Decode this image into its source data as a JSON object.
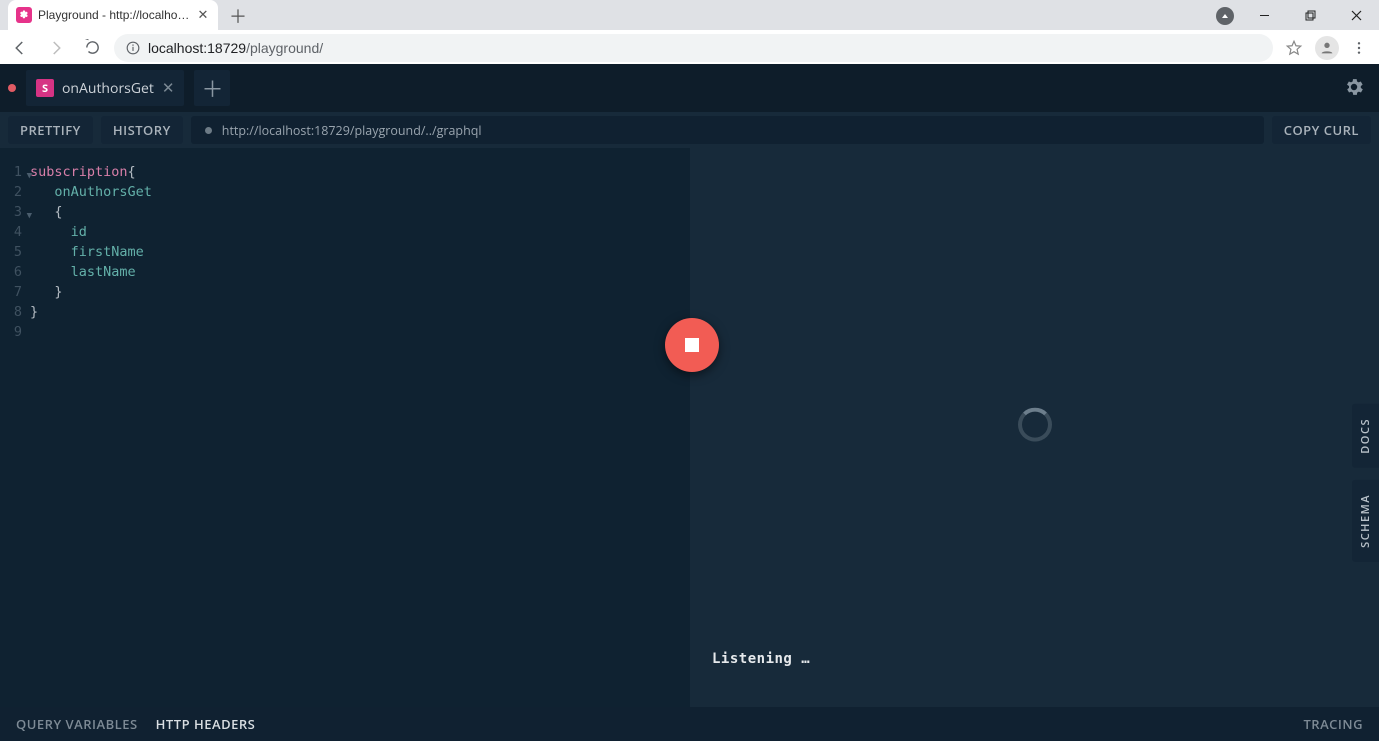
{
  "browser": {
    "tab_title": "Playground - http://localhost:187",
    "url_prefix": "localhost:18729",
    "url_path": "/playground/",
    "window_controls": {
      "min": "minimize",
      "max": "restore",
      "close": "close"
    }
  },
  "app": {
    "tab": {
      "kind": "S",
      "name": "onAuthorsGet"
    },
    "settings_icon": "gear",
    "toolbar": {
      "prettify": "PRETTIFY",
      "history": "HISTORY",
      "copy_curl": "COPY CURL",
      "endpoint": "http://localhost:18729/playground/../graphql"
    },
    "editor": {
      "lines": [
        {
          "n": 1,
          "fold": true,
          "tokens": [
            [
              "kw",
              "subscription"
            ],
            [
              "brace",
              "{"
            ]
          ]
        },
        {
          "n": 2,
          "fold": false,
          "tokens": [
            [
              "plain",
              "   "
            ],
            [
              "field",
              "onAuthorsGet"
            ]
          ]
        },
        {
          "n": 3,
          "fold": true,
          "tokens": [
            [
              "plain",
              "   "
            ],
            [
              "brace",
              "{"
            ]
          ]
        },
        {
          "n": 4,
          "fold": false,
          "tokens": [
            [
              "plain",
              "     "
            ],
            [
              "field",
              "id"
            ]
          ]
        },
        {
          "n": 5,
          "fold": false,
          "tokens": [
            [
              "plain",
              "     "
            ],
            [
              "field",
              "firstName"
            ]
          ]
        },
        {
          "n": 6,
          "fold": false,
          "tokens": [
            [
              "plain",
              "     "
            ],
            [
              "field",
              "lastName"
            ]
          ]
        },
        {
          "n": 7,
          "fold": false,
          "tokens": [
            [
              "plain",
              "   "
            ],
            [
              "brace",
              "}"
            ]
          ]
        },
        {
          "n": 8,
          "fold": false,
          "tokens": [
            [
              "brace",
              "}"
            ]
          ]
        },
        {
          "n": 9,
          "fold": false,
          "tokens": []
        }
      ]
    },
    "run_button_state": "stop",
    "result": {
      "status": "Listening …"
    },
    "side_tabs": {
      "docs": "DOCS",
      "schema": "SCHEMA"
    },
    "bottom": {
      "query_variables": "QUERY VARIABLES",
      "http_headers": "HTTP HEADERS",
      "tracing": "TRACING"
    }
  }
}
